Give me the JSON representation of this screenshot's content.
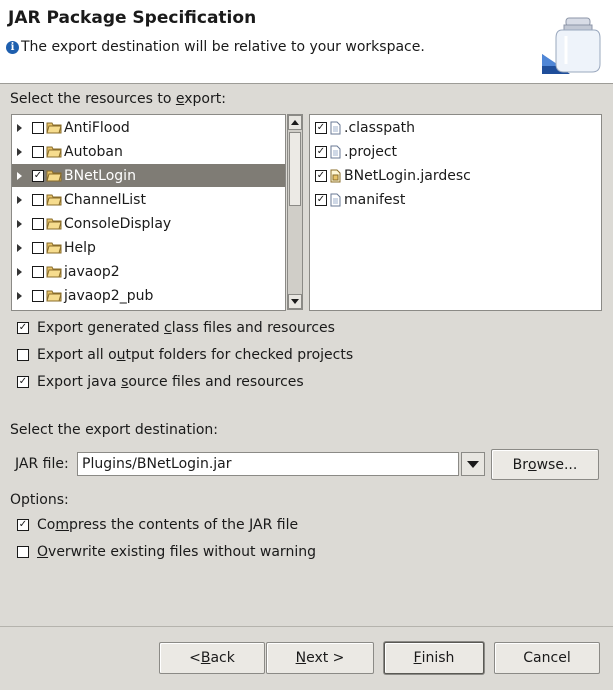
{
  "header": {
    "title": "JAR Package Specification",
    "message": "The export destination will be relative to your workspace.",
    "info_icon_text": "i"
  },
  "resources": {
    "label_pre": "Select the resources to ",
    "label_mn": "e",
    "label_post": "xport:",
    "projects": [
      {
        "name": "AntiFlood",
        "checked": false,
        "selected": false
      },
      {
        "name": "Autoban",
        "checked": false,
        "selected": false
      },
      {
        "name": "BNetLogin",
        "checked": true,
        "selected": true
      },
      {
        "name": "ChannelList",
        "checked": false,
        "selected": false
      },
      {
        "name": "ConsoleDisplay",
        "checked": false,
        "selected": false
      },
      {
        "name": "Help",
        "checked": false,
        "selected": false
      },
      {
        "name": "javaop2",
        "checked": false,
        "selected": false
      },
      {
        "name": "javaop2_pub",
        "checked": false,
        "selected": false
      }
    ],
    "files": [
      {
        "name": ".classpath",
        "checked": true
      },
      {
        "name": ".project",
        "checked": true
      },
      {
        "name": "BNetLogin.jardesc",
        "checked": true
      },
      {
        "name": "manifest",
        "checked": true
      }
    ]
  },
  "options_export": [
    {
      "pre": "Export generated ",
      "mn": "c",
      "post": "lass files and resources",
      "checked": true
    },
    {
      "pre": "Export all o",
      "mn": "u",
      "post": "tput folders for checked projects",
      "checked": false
    },
    {
      "pre": "Export java ",
      "mn": "s",
      "post": "ource files and resources",
      "checked": true
    }
  ],
  "destination": {
    "label": "Select the export destination:",
    "jar_label_pre": "",
    "jar_label_mn": "J",
    "jar_label_post": "AR file:",
    "jar_value": "Plugins/BNetLogin.jar",
    "browse_pre": "Br",
    "browse_mn": "o",
    "browse_post": "wse..."
  },
  "options": {
    "label": "Options:",
    "items": [
      {
        "pre": "Co",
        "mn": "m",
        "post": "press the contents of the JAR file",
        "checked": true
      },
      {
        "pre": "",
        "mn": "O",
        "post": "verwrite existing files without warning",
        "checked": false
      }
    ]
  },
  "buttons": {
    "back_pre": "< ",
    "back_mn": "B",
    "back_post": "ack",
    "next_pre": "",
    "next_mn": "N",
    "next_post": "ext >",
    "finish_pre": "",
    "finish_mn": "F",
    "finish_post": "inish",
    "cancel": "Cancel"
  },
  "check_glyph": "✓",
  "colors": {
    "dialog_bg": "#dcdad5",
    "selection": "#7f7c75",
    "info_blue": "#1e5fae"
  }
}
